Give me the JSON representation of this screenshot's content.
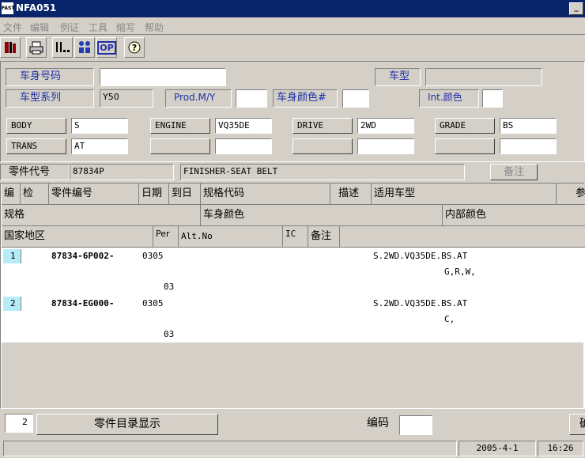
{
  "window": {
    "title": "NFA051",
    "logo_text": "FAST",
    "minimize": "_"
  },
  "menu": [
    "文件",
    "编辑",
    "例证",
    "工具",
    "缩写",
    "帮助"
  ],
  "toolbar": {
    "op_label": "OP"
  },
  "form": {
    "body_no_label": "车身号码",
    "body_no_value": "",
    "car_type_label": "车型",
    "car_type_value": "",
    "series_label": "车型系列",
    "series_value": "Y50",
    "prod_my_label": "Prod.M/Y",
    "prod_my_value": "",
    "body_color_label": "车身颜色#",
    "body_color_value": "",
    "int_color_label": "Int.颜色",
    "int_color_value": "",
    "attrs": [
      {
        "label": "BODY",
        "value": "S"
      },
      {
        "label": "ENGINE",
        "value": "VQ35DE"
      },
      {
        "label": "DRIVE",
        "value": "2WD"
      },
      {
        "label": "GRADE",
        "value": "BS"
      },
      {
        "label": "TRANS",
        "value": "AT"
      }
    ]
  },
  "part": {
    "code_label": "零件代号",
    "code_value": "87834P",
    "name": "FINISHER-SEAT BELT",
    "remark_button": "备注"
  },
  "grid": {
    "header1": [
      "编",
      "检",
      "零件编号",
      "日期",
      "到日",
      "规格代码",
      "描述",
      "适用车型",
      "参"
    ],
    "header2": [
      "规格",
      "车身颜色",
      "内部颜色"
    ],
    "header3": [
      "国家地区",
      "Per",
      "Alt.No",
      "IC",
      "备注"
    ],
    "rows": [
      {
        "index": "1",
        "part_no": "87834-6P002-",
        "date": "0305",
        "models": "S.2WD.VQ35DE.BS.AT",
        "colors": "G,R,W,",
        "end": "03"
      },
      {
        "index": "2",
        "part_no": "87834-EG000-",
        "date": "0305",
        "models": "S.2WD.VQ35DE.BS.AT",
        "colors": "C,",
        "end": "03"
      }
    ]
  },
  "footer": {
    "count": "2",
    "catalog_button": "零件目录显示",
    "code_label": "编码",
    "code_value": "",
    "right_button": "确"
  },
  "status": {
    "date": "2005-4-1",
    "time": "16:26"
  }
}
